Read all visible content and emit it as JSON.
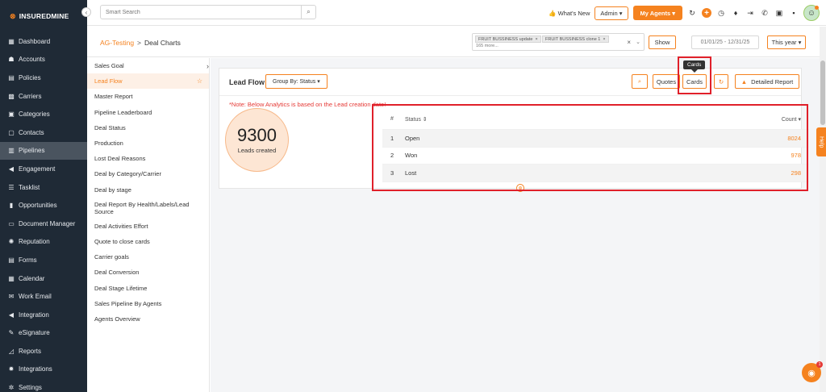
{
  "brand": {
    "logo_mark": "⊗",
    "name": "INSUREDMINE"
  },
  "sidebar": {
    "items": [
      {
        "icon": "dashboard-icon",
        "glyph": "▦",
        "label": "Dashboard"
      },
      {
        "icon": "accounts-icon",
        "glyph": "☗",
        "label": "Accounts"
      },
      {
        "icon": "policies-icon",
        "glyph": "▤",
        "label": "Policies"
      },
      {
        "icon": "carriers-icon",
        "glyph": "▩",
        "label": "Carriers"
      },
      {
        "icon": "categories-icon",
        "glyph": "▣",
        "label": "Categories"
      },
      {
        "icon": "contacts-icon",
        "glyph": "▢",
        "label": "Contacts"
      },
      {
        "icon": "pipelines-icon",
        "glyph": "▥",
        "label": "Pipelines"
      },
      {
        "icon": "engagement-icon",
        "glyph": "◀",
        "label": "Engagement"
      },
      {
        "icon": "tasklist-icon",
        "glyph": "☰",
        "label": "Tasklist"
      },
      {
        "icon": "opportunities-icon",
        "glyph": "▮",
        "label": "Opportunities"
      },
      {
        "icon": "document-manager-icon",
        "glyph": "▭",
        "label": "Document Manager"
      },
      {
        "icon": "reputation-icon",
        "glyph": "✺",
        "label": "Reputation"
      },
      {
        "icon": "forms-icon",
        "glyph": "▤",
        "label": "Forms"
      },
      {
        "icon": "calendar-icon",
        "glyph": "▦",
        "label": "Calendar"
      },
      {
        "icon": "work-email-icon",
        "glyph": "✉",
        "label": "Work Email"
      },
      {
        "icon": "integration-icon",
        "glyph": "◀",
        "label": "Integration"
      },
      {
        "icon": "esignature-icon",
        "glyph": "✎",
        "label": "eSignature"
      },
      {
        "icon": "reports-icon",
        "glyph": "◿",
        "label": "Reports"
      },
      {
        "icon": "integrations-icon",
        "glyph": "✹",
        "label": "Integrations"
      },
      {
        "icon": "settings-icon",
        "glyph": "✲",
        "label": "Settings"
      }
    ],
    "active_index": 6
  },
  "topbar": {
    "search_placeholder": "Smart Search",
    "whats_new": "👍 What's New",
    "admin_label": "Admin ▾",
    "my_agents_label": "My Agents ▾"
  },
  "breadcrumb": {
    "parent": "AG-Testing",
    "separator": ">",
    "current": "Deal Charts"
  },
  "filters": {
    "chips": [
      "FRUIT BUSSINESS update",
      "FRUIT BUSSINESS clone 1"
    ],
    "more": "165 more...",
    "show_label": "Show",
    "date_range": "01/01/25 - 12/31/25",
    "period_label": "This year ▾"
  },
  "reports": {
    "items": [
      "Sales Goal",
      "Lead Flow",
      "Master Report",
      "Pipeline Leaderboard",
      "Deal Status",
      "Production",
      "Lost Deal Reasons",
      "Deal by Category/Carrier",
      "Deal by stage",
      "Deal Report By Health/Labels/Lead Source",
      "Deal Activities Effort",
      "Quote to close cards",
      "Carrier goals",
      "Deal Conversion",
      "Deal Stage Lifetime",
      "Sales Pipeline By Agents",
      "Agents Overview"
    ],
    "active_index": 1
  },
  "panel": {
    "title": "Lead Flow",
    "group_by": "Group By: Status ▾",
    "quotes_label": "Quotes",
    "cards_label": "Cards",
    "tooltip": "Cards",
    "detailed_label": "Detailed Report",
    "note": "*Note: Below Analytics is based on the Lead creation date!",
    "total_value": "9300",
    "total_label": "Leads created"
  },
  "table": {
    "headers": {
      "num": "#",
      "status": "Status ⇕",
      "count": "Count ▾"
    },
    "rows": [
      {
        "num": "1",
        "status": "Open",
        "count": "8024"
      },
      {
        "num": "2",
        "status": "Won",
        "count": "978"
      },
      {
        "num": "3",
        "status": "Lost",
        "count": "298"
      }
    ]
  },
  "help_tab": "Help",
  "chat_badge": "1",
  "colors": {
    "accent": "#f5821f",
    "sidebar_bg": "#1f2a36",
    "highlight": "#e0202a"
  }
}
